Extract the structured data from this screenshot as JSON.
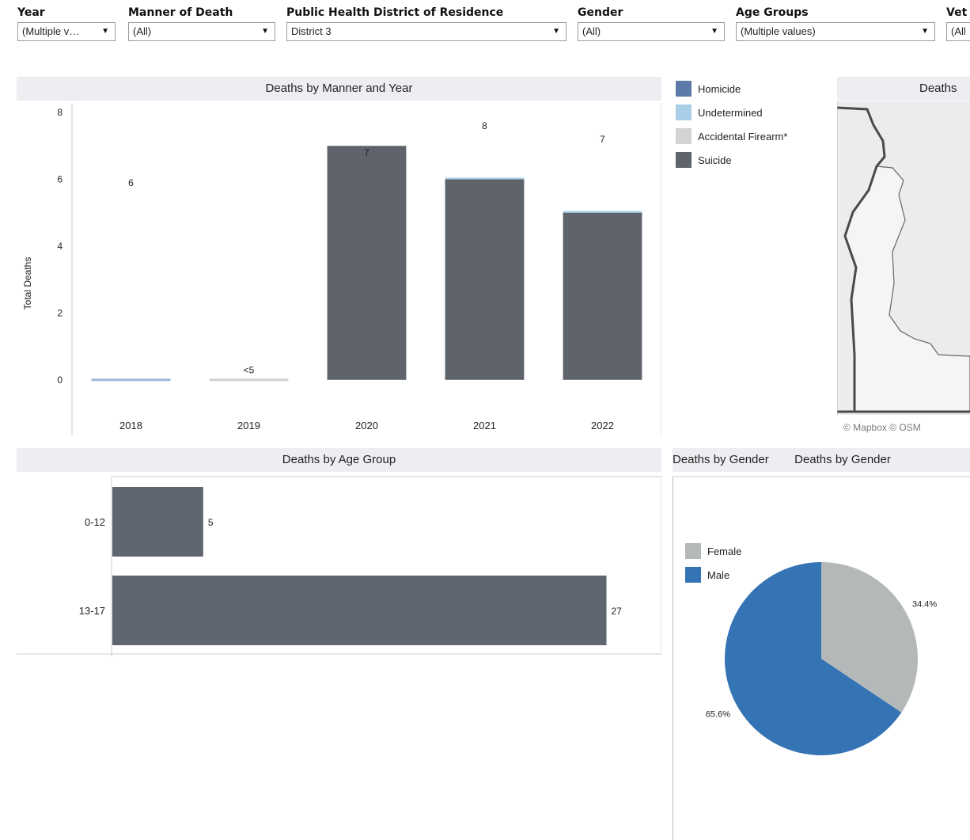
{
  "filters": [
    {
      "label": "Year",
      "value": "(Multiple v…"
    },
    {
      "label": "Manner of Death",
      "value": "(All)"
    },
    {
      "label": "Public Health District of Residence",
      "value": "District 3"
    },
    {
      "label": "Gender",
      "value": "(All)"
    },
    {
      "label": "Age Groups",
      "value": "(Multiple values)"
    },
    {
      "label": "Vet",
      "value": "(All"
    }
  ],
  "panels": {
    "manner_year_title": "Deaths by Manner and Year",
    "map_title": "Deaths",
    "age_title": "Deaths by Age Group",
    "gender_title": "Deaths by Gender",
    "map_credit": "© Mapbox © OSM"
  },
  "manner_legend": [
    {
      "label": "Homicide",
      "color": "#5b7aa8"
    },
    {
      "label": "Undetermined",
      "color": "#a9cfe8"
    },
    {
      "label": "Accidental Firearm*",
      "color": "#d3d3d3"
    },
    {
      "label": "Suicide",
      "color": "#5f636c"
    }
  ],
  "gender_legend": [
    {
      "label": "Female",
      "color": "#b5b8b9"
    },
    {
      "label": "Male",
      "color": "#3574b4"
    }
  ],
  "chart_data": [
    {
      "type": "bar",
      "title": "Deaths by Manner and Year",
      "ylabel": "Total Deaths",
      "ylim": [
        -1,
        8
      ],
      "yticks": [
        "8",
        "6",
        "4",
        "2",
        "0"
      ],
      "categories": [
        "2018",
        "2019",
        "2020",
        "2021",
        "2022"
      ],
      "series": [
        {
          "name": "Homicide",
          "values": [
            0,
            0,
            0,
            0,
            0
          ]
        },
        {
          "name": "Undetermined",
          "values": [
            0,
            0,
            0,
            0.05,
            0.05
          ]
        },
        {
          "name": "Accidental Firearm*",
          "values": [
            0,
            0,
            0,
            0,
            0
          ]
        },
        {
          "name": "Suicide",
          "values": [
            0,
            0,
            7,
            6,
            5
          ]
        }
      ],
      "total_labels": [
        "6",
        "<5",
        "7",
        "8",
        "7"
      ],
      "total_label_y": [
        5.8,
        0.2,
        6.7,
        7.5,
        7.1
      ]
    },
    {
      "type": "bar",
      "orientation": "horizontal",
      "title": "Deaths by Age Group",
      "categories": [
        "0-12",
        "13-17"
      ],
      "values": [
        5,
        27
      ],
      "xlim": [
        0,
        30
      ]
    },
    {
      "type": "pie",
      "title": "Deaths by Gender",
      "categories": [
        "Female",
        "Male"
      ],
      "values": [
        34.4,
        65.6
      ],
      "labels": [
        "34.4%",
        "65.6%"
      ]
    }
  ]
}
